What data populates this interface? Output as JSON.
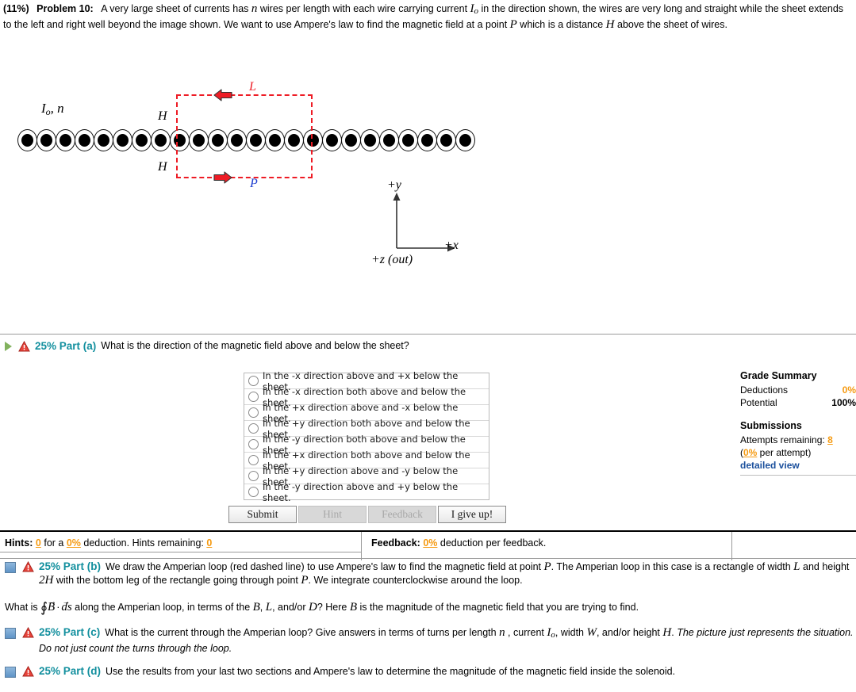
{
  "problem": {
    "weight": "(11%)",
    "number": "Problem 10:",
    "text_1": "A very large sheet of currents has ",
    "var_n": "n",
    "text_2": " wires per length with each wire carrying current ",
    "var_Io": "I",
    "var_Io_sub": "o",
    "text_3": " in the direction shown, the wires are very long and straight while the sheet extends to the left and right well beyond the image shown. We want to use Ampere's law to find the magnetic field at a point ",
    "var_P": "P",
    "text_4": " which is a distance ",
    "var_H": "H",
    "text_5": " above the sheet of wires."
  },
  "figure": {
    "wire_count": 24,
    "label_current": "I",
    "label_current_sub": "o",
    "label_current_rest": ", n",
    "label_L": "L",
    "label_P": "P",
    "label_H_top": "H",
    "label_H_bottom": "H",
    "axis_y": "+y",
    "axis_x": "+x",
    "axis_z": "+z (out)",
    "loop_color": "#ee1c25",
    "point_color": "#1f3fd0"
  },
  "part_a": {
    "percent": "25% Part (a)",
    "question": "What is the direction of the magnetic field above and below the sheet?",
    "choices": [
      "In the -x direction above and +x below the sheet.",
      "In the -x direction both above and below the sheet.",
      "In the +x direction above and -x below the sheet.",
      "In the +y direction both above and below the sheet.",
      "In the -y direction both above and below the sheet.",
      "In the +x direction both above and below the sheet.",
      "In the +y direction above and -y below the sheet.",
      "In the -y direction above and +y below the sheet."
    ],
    "buttons": {
      "submit": "Submit",
      "hint": "Hint",
      "feedback": "Feedback",
      "give_up": "I give up!"
    }
  },
  "grade_summary": {
    "title": "Grade Summary",
    "deductions_label": "Deductions",
    "deductions_value": "0%",
    "potential_label": "Potential",
    "potential_value": "100%",
    "submissions_title": "Submissions",
    "attempts_label": "Attempts remaining:",
    "attempts_value": "8",
    "per_attempt_open": "(",
    "per_attempt_value": "0%",
    "per_attempt_rest": " per attempt)",
    "detailed_view": "detailed view"
  },
  "hints_bar": {
    "hints_label": "Hints:",
    "hints_count": "0",
    "for_a": "for a",
    "hints_deduction": "0%",
    "deduction_word": "deduction. Hints remaining:",
    "hints_remaining": "0",
    "feedback_label": "Feedback:",
    "feedback_deduction": "0%",
    "feedback_text": "deduction per feedback."
  },
  "part_b": {
    "percent": "25% Part (b)",
    "text_1": "We draw the Amperian loop (red dashed line) to use Ampere's law to find the magnetic field at point ",
    "var_P": "P",
    "text_2": ". The Amperian loop in this case is a rectangle of width ",
    "var_L": "L",
    "text_3": " and height ",
    "var_2H": "2H",
    "text_4": " with the bottom leg of the rectangle going through point ",
    "var_P2": "P",
    "text_5": ". We integrate counterclockwise around the loop.",
    "question_pre": "What is ",
    "integral_B": "B",
    "integral_ds": "ds",
    "question_mid": " along the Amperian loop, in terms of the ",
    "var_B": "B",
    "var_L2": "L",
    "andor": ", and/or ",
    "var_D": "D",
    "question_post": "? Here ",
    "var_B2": "B",
    "question_end": " is the magnitude of the magnetic field that you are trying to find."
  },
  "part_c": {
    "percent": "25% Part (c)",
    "text_1": "What is the current through the Amperian loop? Give answers in terms of turns per length ",
    "var_n": "n",
    "text_2": " , current ",
    "var_Io": "I",
    "var_Io_sub": "o",
    "text_3": ", width ",
    "var_W": "W",
    "text_4": ", and/or height ",
    "var_H": "H",
    "text_5": ". ",
    "italic_1": "The picture just represents the situation. Do not just count the turns through the loop."
  },
  "part_d": {
    "percent": "25% Part (d)",
    "text_1": "Use the results from your last two sections and Ampere's law to determine the magnitude of the magnetic field inside the solenoid."
  },
  "colors": {
    "teal": "#128f9e",
    "orange": "#f59a11",
    "blue_link": "#1a4f9c",
    "red": "#ee1c25"
  }
}
